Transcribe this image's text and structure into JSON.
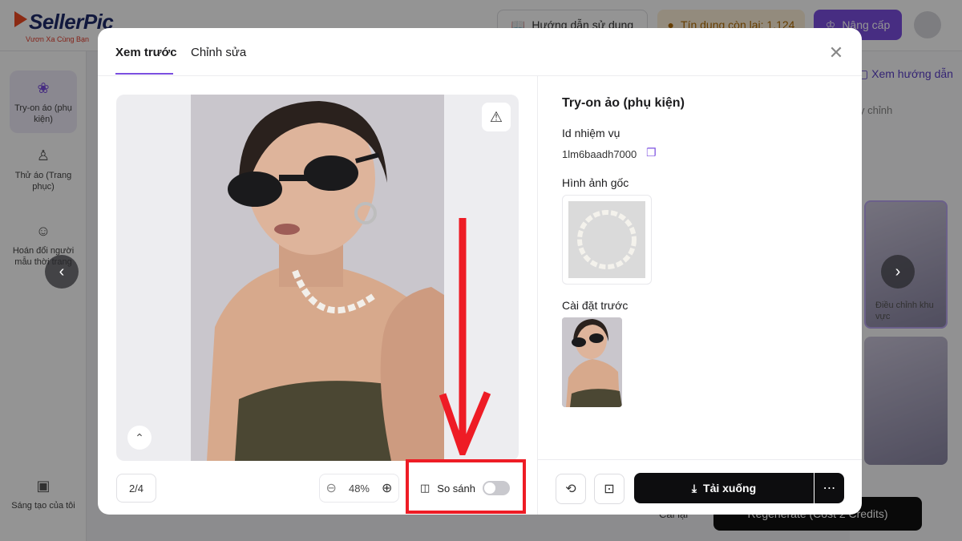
{
  "app": {
    "brand": "SellerPic",
    "slogan": "Vươn Xa Cùng Bạn",
    "guide_label": "Hướng dẫn sử dụng",
    "credits_label": "Tín dụng còn lại: 1,124",
    "upgrade_label": "Nâng cấp"
  },
  "sidebar": {
    "items": [
      {
        "label": "Try-on áo (phụ kiện)",
        "icon": "hanger-icon"
      },
      {
        "label": "Thử áo (Trang phục)",
        "icon": "shirt-icon"
      },
      {
        "label": "Hoán đổi người mẫu thời trang",
        "icon": "model-swap-icon"
      },
      {
        "label": "Sáng tạo của tôi",
        "icon": "folder-icon"
      }
    ]
  },
  "right_panel": {
    "guide_link": "Xem hướng dẫn",
    "sub_label": "y chỉnh",
    "adjust_label": "Điều chỉnh khu vực",
    "reset_label": "Cài lại",
    "regenerate_label": "Regenerate (Cost 2 Credits)"
  },
  "modal": {
    "tabs": [
      {
        "label": "Xem trước",
        "active": true
      },
      {
        "label": "Chỉnh sửa",
        "active": false
      }
    ],
    "page_indicator": "2/4",
    "zoom_level": "48%",
    "compare_label": "So sánh",
    "compare_enabled": false,
    "details": {
      "title": "Try-on ảo (phụ kiện)",
      "task_id_label": "Id nhiệm vụ",
      "task_id_value": "1lm6baadh7000",
      "original_image_label": "Hình ảnh gốc",
      "preset_label": "Cài đặt trước"
    },
    "download_label": "Tải xuống"
  },
  "colors": {
    "accent": "#7b4fe0",
    "annotation_red": "#ee1c25",
    "primary_button": "#0d0d0f"
  }
}
